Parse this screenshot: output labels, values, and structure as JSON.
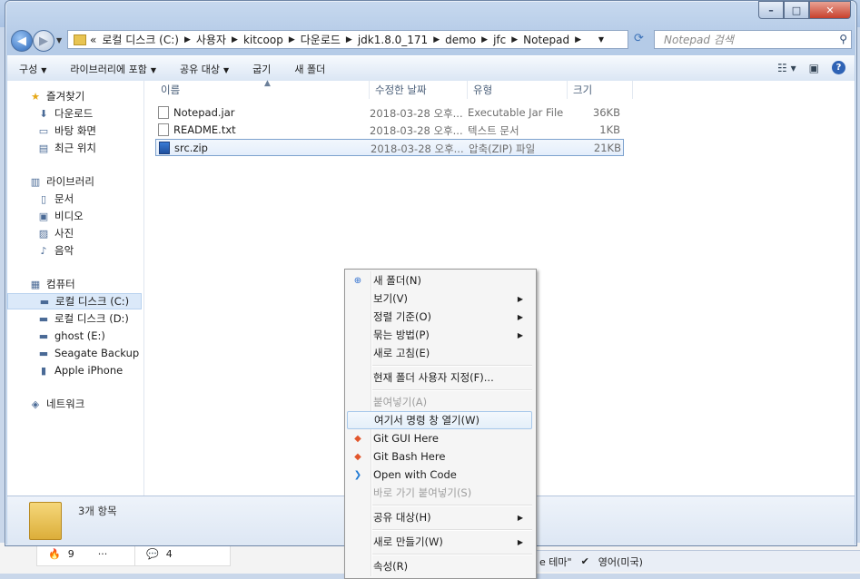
{
  "background": {
    "reactions": [
      {
        "icon": "fire-emoji",
        "count": "9"
      },
      {
        "label": "···"
      }
    ],
    "comments": {
      "count": "4"
    },
    "taskbar": {
      "theme_fragment": "e 테마\"",
      "language": "영어(미국)"
    }
  },
  "window": {
    "controls": {
      "minimize": "–",
      "maximize": "□",
      "close": "✕"
    }
  },
  "address": {
    "prefix": "«",
    "crumbs": [
      "로컬 디스크 (C:)",
      "사용자",
      "kitcoop",
      "다운로드",
      "jdk1.8.0_171",
      "demo",
      "jfc",
      "Notepad"
    ],
    "search_placeholder": "Notepad 검색"
  },
  "toolbar": {
    "items": [
      "구성",
      "라이브러리에 포함",
      "공유 대상",
      "굽기",
      "새 폴더"
    ],
    "has_arrow": [
      true,
      true,
      true,
      false,
      false
    ]
  },
  "nav_pane": {
    "items": [
      {
        "label": "즐겨찾기",
        "icon": "star-icon",
        "indent": 0
      },
      {
        "label": "다운로드",
        "icon": "download-icon",
        "indent": 1
      },
      {
        "label": "바탕 화면",
        "icon": "desktop-icon",
        "indent": 1
      },
      {
        "label": "최근 위치",
        "icon": "recent-icon",
        "indent": 1
      },
      {
        "label": "라이브러리",
        "icon": "library-icon",
        "indent": 0
      },
      {
        "label": "문서",
        "icon": "document-icon",
        "indent": 1
      },
      {
        "label": "비디오",
        "icon": "video-icon",
        "indent": 1
      },
      {
        "label": "사진",
        "icon": "picture-icon",
        "indent": 1
      },
      {
        "label": "음악",
        "icon": "music-icon",
        "indent": 1
      },
      {
        "label": "컴퓨터",
        "icon": "computer-icon",
        "indent": 0
      },
      {
        "label": "로컬 디스크 (C:)",
        "icon": "drive-icon",
        "indent": 1,
        "selected": true
      },
      {
        "label": "로컬 디스크 (D:)",
        "icon": "drive-icon",
        "indent": 1
      },
      {
        "label": "ghost (E:)",
        "icon": "drive-icon",
        "indent": 1
      },
      {
        "label": "Seagate Backup Plu",
        "icon": "drive-icon",
        "indent": 1
      },
      {
        "label": "Apple iPhone",
        "icon": "phone-icon",
        "indent": 1
      },
      {
        "label": "네트워크",
        "icon": "network-icon",
        "indent": 0
      }
    ]
  },
  "file_list": {
    "columns": [
      "이름",
      "수정한 날짜",
      "유형",
      "크기"
    ],
    "rows": [
      {
        "name": "Notepad.jar",
        "date": "2018-03-28 오후...",
        "type": "Executable Jar File",
        "size": "36KB"
      },
      {
        "name": "README.txt",
        "date": "2018-03-28 오후...",
        "type": "텍스트 문서",
        "size": "1KB"
      },
      {
        "name": "src.zip",
        "date": "2018-03-28 오후...",
        "type": "압축(ZIP) 파일",
        "size": "21KB",
        "selected": true
      }
    ]
  },
  "details": {
    "item_count": "3개 항목"
  },
  "context_menu": {
    "items": [
      {
        "label": "새 폴더(N)",
        "icon": "new-folder-icon"
      },
      {
        "label": "보기(V)",
        "submenu": true
      },
      {
        "label": "정렬 기준(O)",
        "submenu": true
      },
      {
        "label": "묶는 방법(P)",
        "submenu": true
      },
      {
        "label": "새로 고침(E)"
      },
      {
        "separator": true
      },
      {
        "label": "현재 폴더 사용자 지정(F)..."
      },
      {
        "separator": true
      },
      {
        "label": "붙여넣기(A)",
        "disabled": true
      },
      {
        "label": "여기서 명령 창 열기(W)",
        "highlighted": true
      },
      {
        "label": "Git GUI Here",
        "icon": "git-icon"
      },
      {
        "label": "Git Bash Here",
        "icon": "git-icon"
      },
      {
        "label": "Open with Code",
        "icon": "vscode-icon"
      },
      {
        "label": "바로 가기 붙여넣기(S)",
        "disabled": true
      },
      {
        "separator": true
      },
      {
        "label": "공유 대상(H)",
        "submenu": true
      },
      {
        "separator": true
      },
      {
        "label": "새로 만들기(W)",
        "submenu": true
      },
      {
        "separator": true
      },
      {
        "label": "속성(R)"
      }
    ]
  },
  "colors": {
    "accent": "#2f63b5",
    "selection": "#dbe9f9",
    "menu_highlight": "#a8c8ea"
  }
}
